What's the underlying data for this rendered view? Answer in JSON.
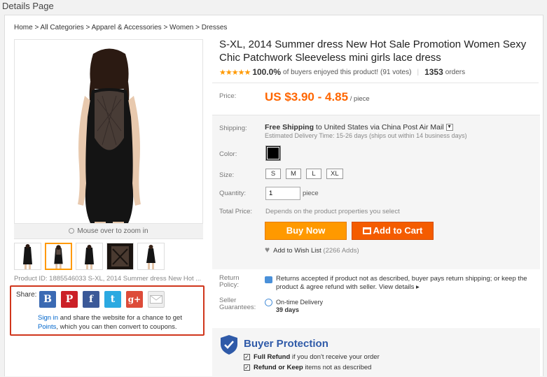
{
  "page_label": "Details Page",
  "breadcrumb": "Home > All Categories > Apparel & Accessories > Women > Dresses",
  "gallery": {
    "zoom_hint": "Mouse over to zoom in",
    "product_id": "Product ID: 1885546033 S-XL, 2014 Summer dress New Hot ..."
  },
  "share": {
    "label": "Share:",
    "icons": [
      "B",
      "P",
      "f",
      "t",
      "g+",
      ""
    ],
    "sign_in": "Sign in",
    "text_mid": " and share the website for a chance to get ",
    "points": "Points",
    "text_end": ", which you can then convert to coupons."
  },
  "product": {
    "title": "S-XL, 2014 Summer dress New Hot Sale Promotion Women Sexy Chic Patchwork Sleeveless mini girls lace dress",
    "stars": "★★★★★",
    "rating_pct": "100.0%",
    "rating_text": "of buyers enjoyed this product! (91 votes)",
    "orders_count": "1353",
    "orders_label": "orders"
  },
  "price": {
    "label": "Price:",
    "value": "US $3.90 - 4.85",
    "unit": " / piece"
  },
  "shipping": {
    "label": "Shipping:",
    "free": "Free Shipping",
    "to": " to ",
    "destination": "United States via China Post Air Mail",
    "estimate": "Estimated Delivery Time: 15-26 days (ships out within 14 business days)"
  },
  "color": {
    "label": "Color:",
    "swatch": "#000000"
  },
  "size": {
    "label": "Size:",
    "options": [
      "S",
      "M",
      "L",
      "XL"
    ]
  },
  "quantity": {
    "label": "Quantity:",
    "value": "1",
    "unit": "piece"
  },
  "total": {
    "label": "Total Price:",
    "value": "Depends on the product properties you select"
  },
  "buttons": {
    "buy_now": "Buy Now",
    "add_to_cart": "Add to Cart"
  },
  "wishlist": {
    "label": "Add to Wish List",
    "count": "(2266 Adds)"
  },
  "return_policy": {
    "label": "Return Policy:",
    "text": "Returns accepted if product not as described, buyer pays return shipping; or keep the product & agree refund with seller.",
    "link": "View details ▸"
  },
  "guarantee": {
    "label": "Seller Guarantees:",
    "line1": "On-time Delivery",
    "line2": "39 days"
  },
  "buyer_protection": {
    "title": "Buyer Protection",
    "item1_bold": "Full Refund",
    "item1_rest": " if you don't receive your order",
    "item2_bold": "Refund or Keep",
    "item2_rest": " items not as described"
  },
  "colors": {
    "accent_orange": "#f60",
    "buy_btn": "#f90",
    "cart_btn": "#f45c00",
    "link": "#06c",
    "share_border": "#d0361c"
  }
}
